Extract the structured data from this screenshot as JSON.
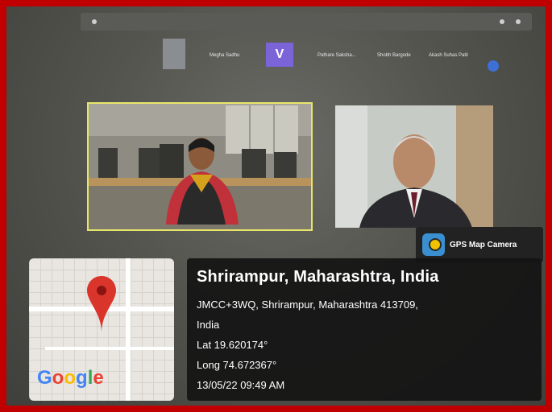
{
  "gps_badge": {
    "label": "GPS Map Camera"
  },
  "map": {
    "brand_letters": [
      "G",
      "o",
      "o",
      "g",
      "l",
      "e"
    ],
    "brand_colors": [
      "#4285F4",
      "#EA4335",
      "#FBBC05",
      "#4285F4",
      "#34A853",
      "#EA4335"
    ]
  },
  "location": {
    "title": "Shrirampur, Maharashtra, India",
    "address_line1": "JMCC+3WQ, Shrirampur, Maharashtra 413709,",
    "address_line2": "India",
    "lat": "Lat 19.620174°",
    "long": "Long 74.672367°",
    "datetime": "13/05/22 09:49 AM"
  },
  "participants": [
    {
      "name": "Megha Sadhu"
    },
    {
      "name": "Pathare Saksha..."
    },
    {
      "name": "Shobh Bargode"
    },
    {
      "name": "Akash Suhas Patil"
    }
  ]
}
